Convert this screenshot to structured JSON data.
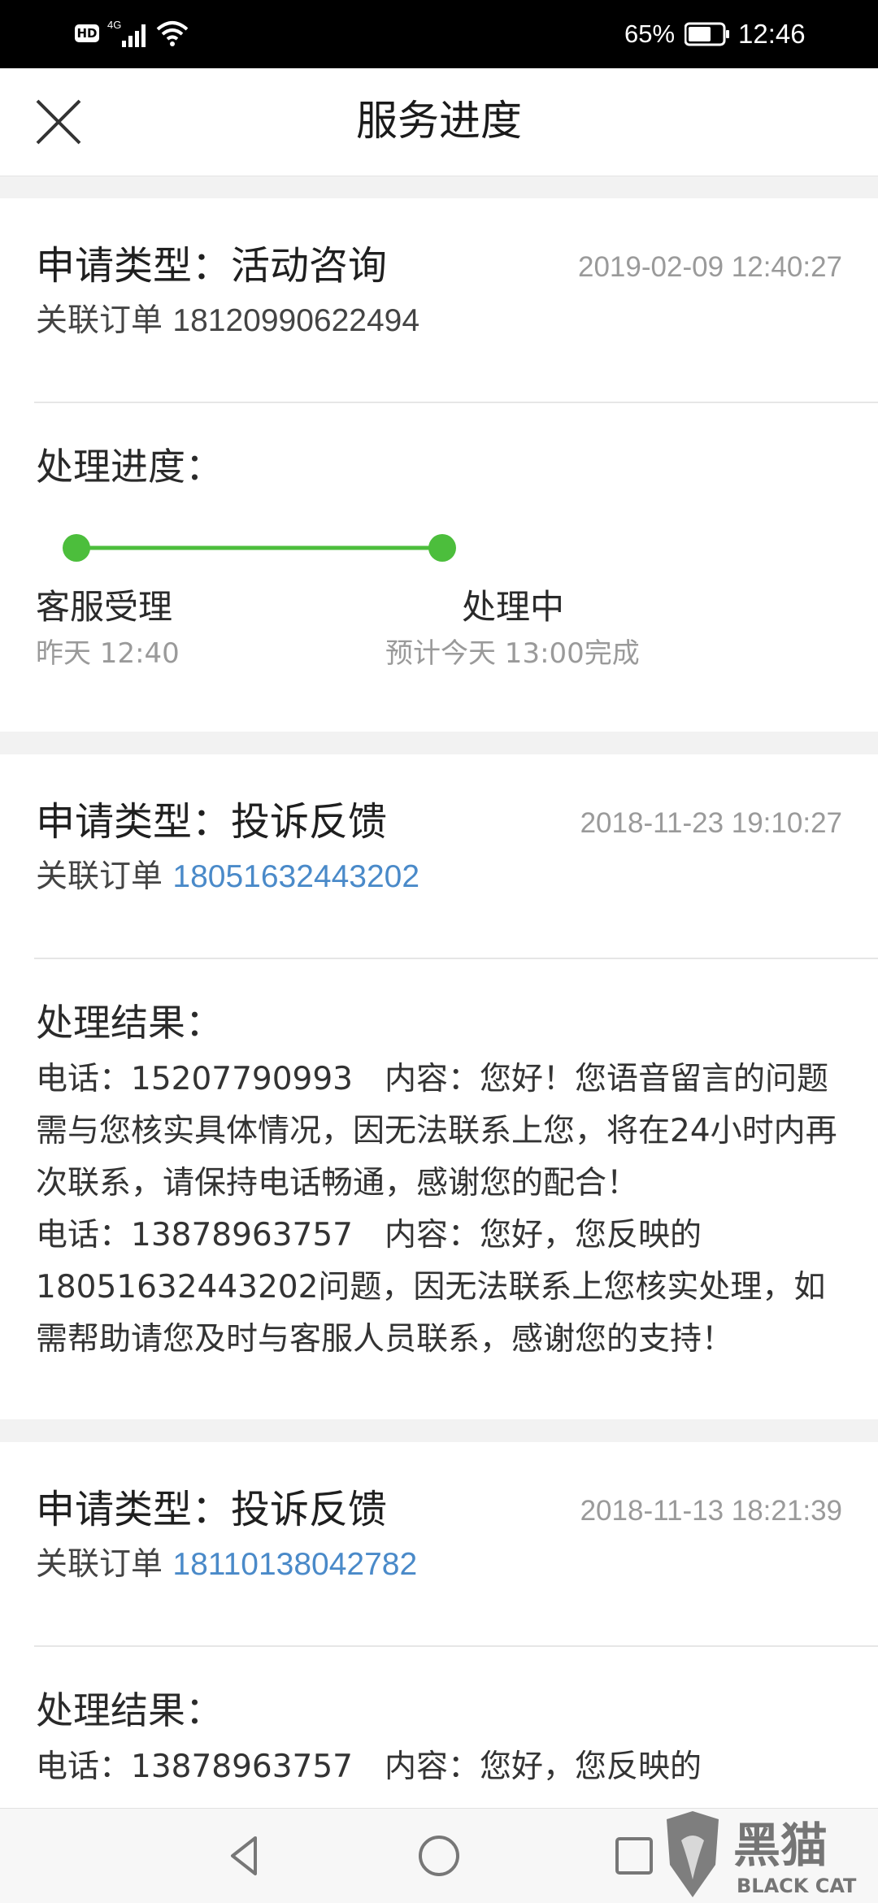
{
  "status_bar": {
    "hd": "HD",
    "network": "4G",
    "battery": "65%",
    "time": "12:46"
  },
  "header": {
    "title": "服务进度"
  },
  "cards": [
    {
      "type": "申请类型：活动咨询",
      "date": "2019-02-09 12:40:27",
      "order_prefix": "关联订单 ",
      "order_number": "18120990622494",
      "progress": {
        "title": "处理进度：",
        "steps": [
          {
            "label": "客服受理",
            "time": "昨天 12:40"
          },
          {
            "label": "处理中",
            "time": "预计今天 13:00完成"
          }
        ]
      }
    },
    {
      "type": "申请类型：投诉反馈",
      "date": "2018-11-23 19:10:27",
      "order_prefix": "关联订单 ",
      "order_number": "18051632443202",
      "result": {
        "title": "处理结果：",
        "text": "电话：15207790993　内容：您好！您语音留言的问题需与您核实具体情况，因无法联系上您，将在24小时内再次联系，请保持电话畅通，感谢您的配合！\n电话：13878963757　内容：您好，您反映的18051632443202问题，因无法联系上您核实处理，如需帮助请您及时与客服人员联系，感谢您的支持！"
      }
    },
    {
      "type": "申请类型：投诉反馈",
      "date": "2018-11-13 18:21:39",
      "order_prefix": "关联订单 ",
      "order_number": "18110138042782",
      "result": {
        "title": "处理结果：",
        "text": "电话：13878963757　内容：您好，您反映的"
      }
    }
  ],
  "watermark": {
    "brand": "黑猫",
    "sub": "BLACK CAT"
  },
  "colors": {
    "accent_green": "#4cbe3c",
    "link_blue": "#4a8ac9"
  }
}
